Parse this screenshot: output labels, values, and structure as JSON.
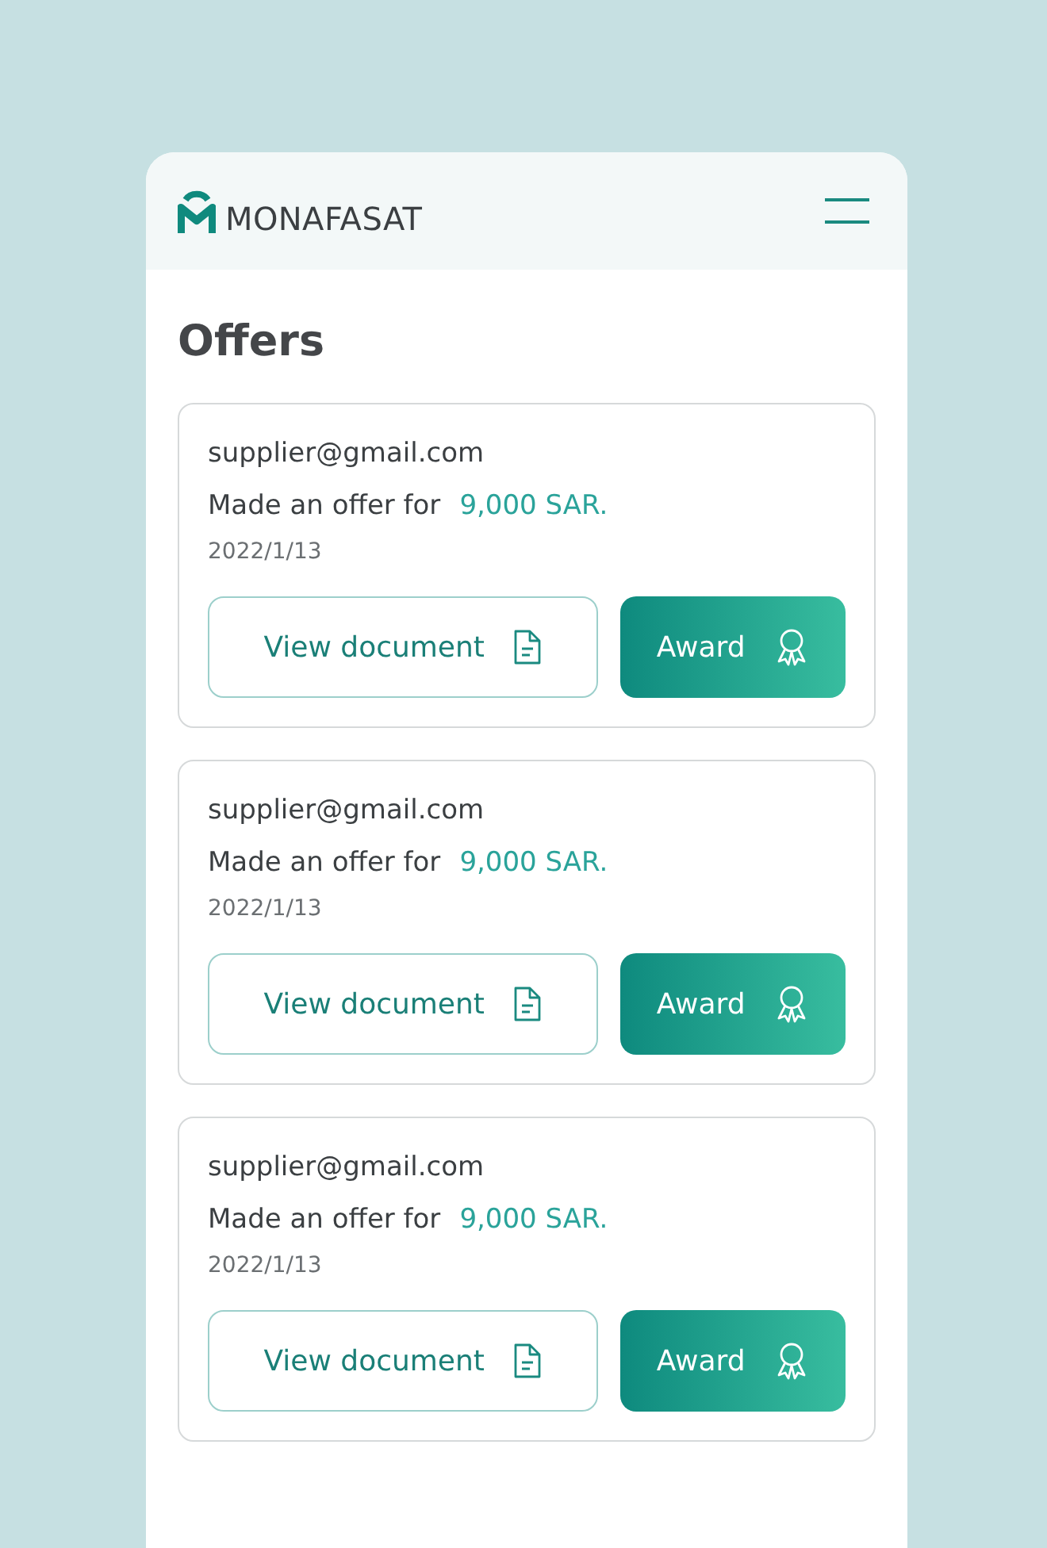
{
  "header": {
    "logo_text": "MONAFASAT"
  },
  "title": "Offers",
  "offers": [
    {
      "email": "supplier@gmail.com",
      "offer_label": "Made an offer for",
      "amount": "9,000 SAR.",
      "date": "2022/1/13",
      "view_button": "View document",
      "award_button": "Award"
    },
    {
      "email": "supplier@gmail.com",
      "offer_label": "Made an offer for",
      "amount": "9,000 SAR.",
      "date": "2022/1/13",
      "view_button": "View document",
      "award_button": "Award"
    },
    {
      "email": "supplier@gmail.com",
      "offer_label": "Made an offer for",
      "amount": "9,000 SAR.",
      "date": "2022/1/13",
      "view_button": "View document",
      "award_button": "Award"
    }
  ]
}
